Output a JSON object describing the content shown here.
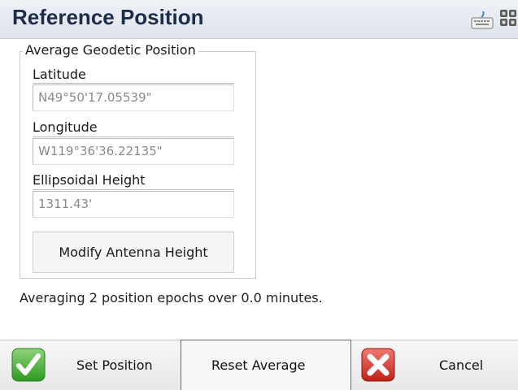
{
  "title": "Reference Position",
  "icons": {
    "keyboard": "keyboard-icon",
    "tray": "tray-icon",
    "check": "check-icon",
    "cancel": "x-icon"
  },
  "group": {
    "legend": "Average Geodetic Position",
    "latitude_label": "Latitude",
    "latitude_value": "N49°50'17.05539\"",
    "longitude_label": "Longitude",
    "longitude_value": "W119°36'36.22135\"",
    "height_label": "Ellipsoidal Height",
    "height_value": "1311.43'",
    "modify_label": "Modify Antenna Height"
  },
  "status": "Averaging 2 position epochs over 0.0 minutes.",
  "bottom": {
    "set_label": "Set Position",
    "reset_label": "Reset Average",
    "cancel_label": "Cancel"
  },
  "colors": {
    "title": "#1c2c4a",
    "check": "#3aa62a",
    "cancel": "#c72a22"
  }
}
